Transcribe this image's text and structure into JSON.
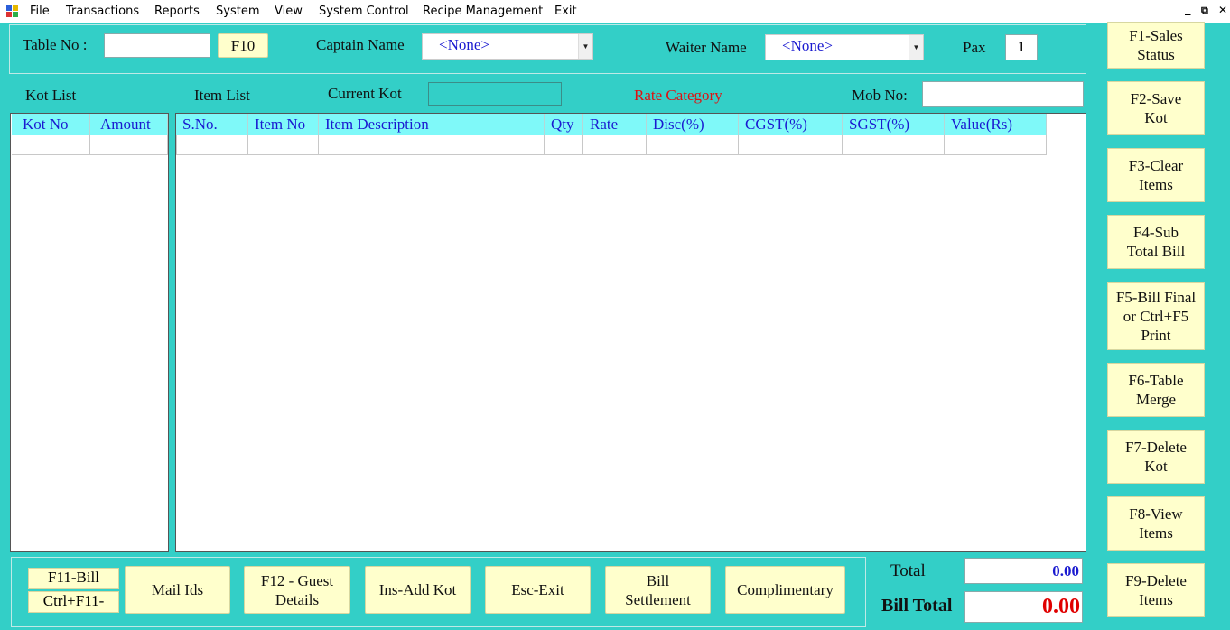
{
  "menu": [
    "File",
    "Transactions",
    "Reports",
    "System",
    "View",
    "System Control",
    "Recipe Management",
    "Exit"
  ],
  "window_controls": {
    "minimize": "_",
    "restore": "⧉",
    "close": "✕"
  },
  "top": {
    "table_no_label": "Table No :",
    "table_no_value": "",
    "f10_label": "F10",
    "captain_label": "Captain Name",
    "captain_value": "<None>",
    "waiter_label": "Waiter Name",
    "waiter_value": "<None>",
    "pax_label": "Pax",
    "pax_value": "1"
  },
  "section": {
    "kot_list": "Kot List",
    "item_list": "Item List",
    "current_kot": "Current Kot",
    "current_kot_value": "",
    "rate_category": "Rate Category",
    "mob_no": "Mob No:",
    "mob_no_value": ""
  },
  "kot_table": {
    "columns": [
      "Kot No",
      "Amount"
    ]
  },
  "item_table": {
    "columns": [
      "S.No.",
      "Item No",
      "Item Description",
      "Qty",
      "Rate",
      "Disc(%)",
      "CGST(%)",
      "SGST(%)",
      "Value(Rs)"
    ]
  },
  "bottom": {
    "f11_bill": "F11-Bill",
    "ctrl_f11": "Ctrl+F11-",
    "mail_ids": "Mail Ids",
    "f12_guest": "F12 - Guest\nDetails",
    "ins_add_kot": "Ins-Add Kot",
    "esc_exit": "Esc-Exit",
    "bill_settlement": "Bill\nSettlement",
    "complimentary": "Complimentary"
  },
  "totals": {
    "total_label": "Total",
    "total_value": "0.00",
    "bill_total_label": "Bill Total",
    "bill_total_value": "0.00",
    "total_color": "#1a1ad0",
    "bill_total_color": "#e00000"
  },
  "side_buttons": [
    "F1-Sales\nStatus",
    "F2-Save\nKot",
    "F3-Clear\nItems",
    "F4-Sub\nTotal Bill",
    "F5-Bill Final\nor  Ctrl+F5\nPrint",
    "F6-Table\nMerge",
    "F7-Delete\nKot",
    "F8-View\nItems",
    "F9-Delete\nItems"
  ]
}
